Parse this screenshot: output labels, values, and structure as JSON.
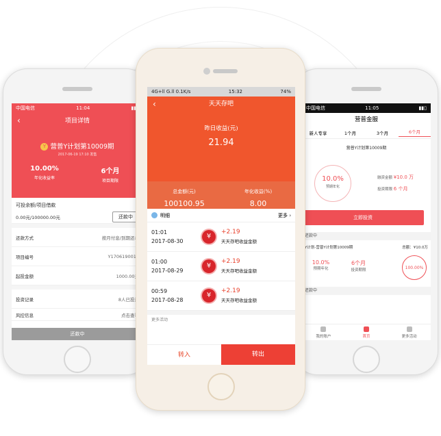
{
  "left": {
    "status": {
      "carrier": "中国电信",
      "time": "11:04"
    },
    "title": "项目详情",
    "plan_name": "营普Y计划第10009期",
    "plan_date": "2017-06-19 17:10 发售",
    "rate": "10.00%",
    "rate_label": "年化收益率",
    "period": "6个月",
    "period_label": "项目期限",
    "balance_label": "可投余额/项目借款",
    "balance_value": "0.00元/100000.00元",
    "repay_button": "还款中",
    "rows": [
      {
        "k": "还款方式",
        "v": "按月付息/到期还本"
      },
      {
        "k": "项目编号",
        "v": "Y1706190011"
      },
      {
        "k": "起投金额",
        "v": "1000.00元"
      },
      {
        "k": "投资记录",
        "v": "8人已投资"
      },
      {
        "k": "风控信息",
        "v": "点击查看"
      }
    ],
    "footer": "还款中"
  },
  "center": {
    "status": {
      "signal": "4G+ll G.ll 0.1K/s",
      "time": "15:32",
      "battery": "74%"
    },
    "title": "天天存吧",
    "yesterday_label": "昨日收益(元)",
    "yesterday_value": "21.94",
    "total_label": "总金额(元)",
    "total_value": "100100.95",
    "annual_label": "年化收益(%)",
    "annual_value": "8.00",
    "detail_label": "明细",
    "more_label": "更多",
    "records": [
      {
        "time": "01:01",
        "date": "2017-08-30",
        "amount": "+2.19",
        "desc": "天天存吧收益金额"
      },
      {
        "time": "01:00",
        "date": "2017-08-29",
        "amount": "+2.19",
        "desc": "天天存吧收益金额"
      },
      {
        "time": "00:59",
        "date": "2017-08-28",
        "amount": "+2.19",
        "desc": "天天存吧收益金额"
      }
    ],
    "partial_row": "更多活动",
    "btn_in": "转入",
    "btn_out": "转出"
  },
  "right": {
    "status": {
      "carrier": "中国电信",
      "time": "11:05"
    },
    "title": "营普金服",
    "tabs": [
      "新人专享",
      "1个月",
      "3个月",
      "6个月"
    ],
    "active_tab": "6个月",
    "plan_name": "营普Y计划第10009期",
    "rate": "10.0%",
    "rate_label": "预期年化",
    "finance_label": "融资金额",
    "finance_value": "¥10.0 万",
    "period_label": "投资期限",
    "period_value": "6 个月",
    "invest_button": "立即投资",
    "section1": "还款中",
    "line_plan": "Y计划-营普Y计划第10009期",
    "line_total": "总额：¥10.0万",
    "row_rate": "10.0%",
    "row_rate_label": "预期年化",
    "row_period": "6个月",
    "row_period_label": "投资期限",
    "row_progress": "100.00%",
    "section2": "还款中",
    "nav": [
      "我的账户",
      "首页",
      "更多活动"
    ],
    "nav_active": "首页"
  }
}
